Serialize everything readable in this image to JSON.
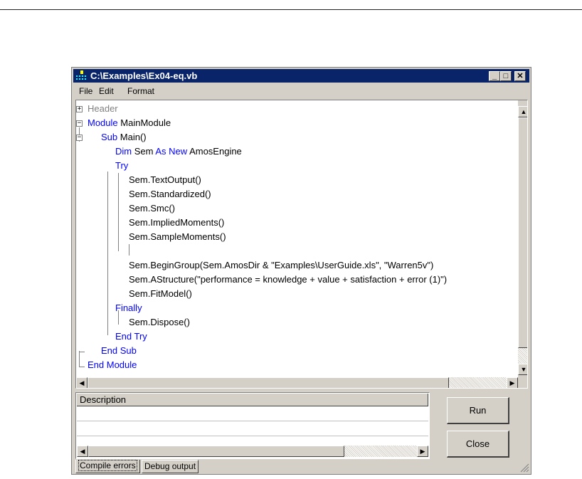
{
  "window": {
    "title": "C:\\Examples\\Ex04-eq.vb",
    "minimize_glyph": "_",
    "maximize_glyph": "□",
    "close_glyph": "✕"
  },
  "menu": [
    "File",
    "Edit",
    "Format"
  ],
  "code": {
    "header": "Header",
    "module_kw": "Module",
    "module_name": "MainModule",
    "sub_kw": "Sub",
    "sub_name": "Main()",
    "dim_kw": "Dim",
    "dim_var": "Sem",
    "as_new_kw": "As New",
    "dim_type": "AmosEngine",
    "try_kw": "Try",
    "lines": [
      "Sem.TextOutput()",
      "Sem.Standardized()",
      "Sem.Smc()",
      "Sem.ImpliedMoments()",
      "Sem.SampleMoments()",
      "",
      "Sem.BeginGroup(Sem.AmosDir & \"Examples\\UserGuide.xls\", \"Warren5v\")",
      "Sem.AStructure(\"performance = knowledge + value + satisfaction + error (1)\")",
      "Sem.FitModel()"
    ],
    "finally_kw": "Finally",
    "dispose_line": "Sem.Dispose()",
    "end_try_kw": "End Try",
    "end_sub_kw": "End Sub",
    "end_module_kw": "End Module"
  },
  "description": {
    "header": "Description"
  },
  "buttons": {
    "run": "Run",
    "close": "Close"
  },
  "tabs": [
    "Compile errors",
    "Debug output"
  ],
  "colors": {
    "keyword": "#0000ff",
    "titlebar": "#0a246a",
    "face": "#d4d0c8"
  }
}
